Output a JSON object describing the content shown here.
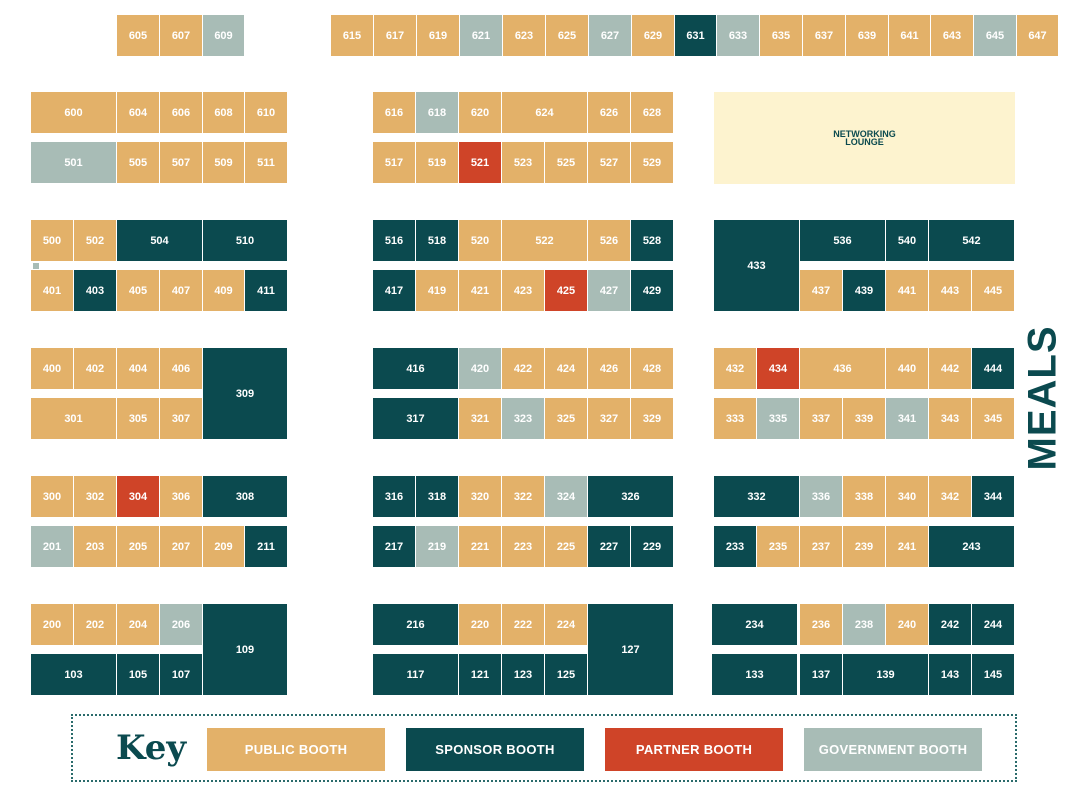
{
  "colors": {
    "public": "#e3b169",
    "sponsor": "#0b4a4f",
    "partner": "#cf4428",
    "government": "#a8bcb6",
    "lounge": "#fdf3cf"
  },
  "booths": [
    {
      "id": "605",
      "type": "public"
    },
    {
      "id": "607",
      "type": "public"
    },
    {
      "id": "609",
      "type": "government"
    },
    {
      "id": "615",
      "type": "public"
    },
    {
      "id": "617",
      "type": "public"
    },
    {
      "id": "619",
      "type": "public"
    },
    {
      "id": "621",
      "type": "government"
    },
    {
      "id": "623",
      "type": "public"
    },
    {
      "id": "625",
      "type": "public"
    },
    {
      "id": "627",
      "type": "government"
    },
    {
      "id": "629",
      "type": "public"
    },
    {
      "id": "631",
      "type": "sponsor"
    },
    {
      "id": "633",
      "type": "government"
    },
    {
      "id": "635",
      "type": "public"
    },
    {
      "id": "637",
      "type": "public"
    },
    {
      "id": "639",
      "type": "public"
    },
    {
      "id": "641",
      "type": "public"
    },
    {
      "id": "643",
      "type": "public"
    },
    {
      "id": "645",
      "type": "government"
    },
    {
      "id": "647",
      "type": "public"
    },
    {
      "id": "600",
      "type": "public"
    },
    {
      "id": "604",
      "type": "public"
    },
    {
      "id": "606",
      "type": "public"
    },
    {
      "id": "608",
      "type": "public"
    },
    {
      "id": "610",
      "type": "public"
    },
    {
      "id": "501",
      "type": "government"
    },
    {
      "id": "505",
      "type": "public"
    },
    {
      "id": "507",
      "type": "public"
    },
    {
      "id": "509",
      "type": "public"
    },
    {
      "id": "511",
      "type": "public"
    },
    {
      "id": "616",
      "type": "public"
    },
    {
      "id": "618",
      "type": "government"
    },
    {
      "id": "620",
      "type": "public"
    },
    {
      "id": "624",
      "type": "public"
    },
    {
      "id": "626",
      "type": "public"
    },
    {
      "id": "628",
      "type": "public"
    },
    {
      "id": "517",
      "type": "public"
    },
    {
      "id": "519",
      "type": "public"
    },
    {
      "id": "521",
      "type": "partner"
    },
    {
      "id": "523",
      "type": "public"
    },
    {
      "id": "525",
      "type": "public"
    },
    {
      "id": "527",
      "type": "public"
    },
    {
      "id": "529",
      "type": "public"
    },
    {
      "id": "500",
      "type": "public"
    },
    {
      "id": "502",
      "type": "public"
    },
    {
      "id": "504",
      "type": "sponsor"
    },
    {
      "id": "510",
      "type": "sponsor"
    },
    {
      "id": "401",
      "type": "public"
    },
    {
      "id": "403",
      "type": "sponsor"
    },
    {
      "id": "405",
      "type": "public"
    },
    {
      "id": "407",
      "type": "public"
    },
    {
      "id": "409",
      "type": "public"
    },
    {
      "id": "411",
      "type": "sponsor"
    },
    {
      "id": "516",
      "type": "sponsor"
    },
    {
      "id": "518",
      "type": "sponsor"
    },
    {
      "id": "520",
      "type": "public"
    },
    {
      "id": "522",
      "type": "public"
    },
    {
      "id": "526",
      "type": "public"
    },
    {
      "id": "528",
      "type": "sponsor"
    },
    {
      "id": "417",
      "type": "sponsor"
    },
    {
      "id": "419",
      "type": "public"
    },
    {
      "id": "421",
      "type": "public"
    },
    {
      "id": "423",
      "type": "public"
    },
    {
      "id": "425",
      "type": "partner"
    },
    {
      "id": "427",
      "type": "government"
    },
    {
      "id": "429",
      "type": "sponsor"
    },
    {
      "id": "433",
      "type": "sponsor"
    },
    {
      "id": "536",
      "type": "sponsor"
    },
    {
      "id": "540",
      "type": "sponsor"
    },
    {
      "id": "542",
      "type": "sponsor"
    },
    {
      "id": "437",
      "type": "public"
    },
    {
      "id": "439",
      "type": "sponsor"
    },
    {
      "id": "441",
      "type": "public"
    },
    {
      "id": "443",
      "type": "public"
    },
    {
      "id": "445",
      "type": "public"
    },
    {
      "id": "400",
      "type": "public"
    },
    {
      "id": "402",
      "type": "public"
    },
    {
      "id": "404",
      "type": "public"
    },
    {
      "id": "406",
      "type": "public"
    },
    {
      "id": "309",
      "type": "sponsor"
    },
    {
      "id": "301",
      "type": "public"
    },
    {
      "id": "305",
      "type": "public"
    },
    {
      "id": "307",
      "type": "public"
    },
    {
      "id": "416",
      "type": "sponsor"
    },
    {
      "id": "420",
      "type": "government"
    },
    {
      "id": "422",
      "type": "public"
    },
    {
      "id": "424",
      "type": "public"
    },
    {
      "id": "426",
      "type": "public"
    },
    {
      "id": "428",
      "type": "public"
    },
    {
      "id": "317",
      "type": "sponsor"
    },
    {
      "id": "321",
      "type": "public"
    },
    {
      "id": "323",
      "type": "government"
    },
    {
      "id": "325",
      "type": "public"
    },
    {
      "id": "327",
      "type": "public"
    },
    {
      "id": "329",
      "type": "public"
    },
    {
      "id": "432",
      "type": "public"
    },
    {
      "id": "434",
      "type": "partner"
    },
    {
      "id": "436",
      "type": "public"
    },
    {
      "id": "440",
      "type": "public"
    },
    {
      "id": "442",
      "type": "public"
    },
    {
      "id": "444",
      "type": "sponsor"
    },
    {
      "id": "333",
      "type": "public"
    },
    {
      "id": "335",
      "type": "government"
    },
    {
      "id": "337",
      "type": "public"
    },
    {
      "id": "339",
      "type": "public"
    },
    {
      "id": "341",
      "type": "government"
    },
    {
      "id": "343",
      "type": "public"
    },
    {
      "id": "345",
      "type": "public"
    },
    {
      "id": "300",
      "type": "public"
    },
    {
      "id": "302",
      "type": "public"
    },
    {
      "id": "304",
      "type": "partner"
    },
    {
      "id": "306",
      "type": "public"
    },
    {
      "id": "308",
      "type": "sponsor"
    },
    {
      "id": "201",
      "type": "government"
    },
    {
      "id": "203",
      "type": "public"
    },
    {
      "id": "205",
      "type": "public"
    },
    {
      "id": "207",
      "type": "public"
    },
    {
      "id": "209",
      "type": "public"
    },
    {
      "id": "211",
      "type": "sponsor"
    },
    {
      "id": "316",
      "type": "sponsor"
    },
    {
      "id": "318",
      "type": "sponsor"
    },
    {
      "id": "320",
      "type": "public"
    },
    {
      "id": "322",
      "type": "public"
    },
    {
      "id": "324",
      "type": "government"
    },
    {
      "id": "326",
      "type": "sponsor"
    },
    {
      "id": "217",
      "type": "sponsor"
    },
    {
      "id": "219",
      "type": "government"
    },
    {
      "id": "221",
      "type": "public"
    },
    {
      "id": "223",
      "type": "public"
    },
    {
      "id": "225",
      "type": "public"
    },
    {
      "id": "227",
      "type": "sponsor"
    },
    {
      "id": "229",
      "type": "sponsor"
    },
    {
      "id": "332",
      "type": "sponsor"
    },
    {
      "id": "336",
      "type": "government"
    },
    {
      "id": "338",
      "type": "public"
    },
    {
      "id": "340",
      "type": "public"
    },
    {
      "id": "342",
      "type": "public"
    },
    {
      "id": "344",
      "type": "sponsor"
    },
    {
      "id": "233",
      "type": "sponsor"
    },
    {
      "id": "235",
      "type": "public"
    },
    {
      "id": "237",
      "type": "public"
    },
    {
      "id": "239",
      "type": "public"
    },
    {
      "id": "241",
      "type": "public"
    },
    {
      "id": "243",
      "type": "sponsor"
    },
    {
      "id": "200",
      "type": "public"
    },
    {
      "id": "202",
      "type": "public"
    },
    {
      "id": "204",
      "type": "public"
    },
    {
      "id": "206",
      "type": "government"
    },
    {
      "id": "109",
      "type": "sponsor"
    },
    {
      "id": "103",
      "type": "sponsor"
    },
    {
      "id": "105",
      "type": "sponsor"
    },
    {
      "id": "107",
      "type": "sponsor"
    },
    {
      "id": "216",
      "type": "sponsor"
    },
    {
      "id": "220",
      "type": "public"
    },
    {
      "id": "222",
      "type": "public"
    },
    {
      "id": "224",
      "type": "public"
    },
    {
      "id": "127",
      "type": "sponsor"
    },
    {
      "id": "117",
      "type": "sponsor"
    },
    {
      "id": "121",
      "type": "sponsor"
    },
    {
      "id": "123",
      "type": "sponsor"
    },
    {
      "id": "125",
      "type": "sponsor"
    },
    {
      "id": "234",
      "type": "sponsor"
    },
    {
      "id": "236",
      "type": "public"
    },
    {
      "id": "238",
      "type": "government"
    },
    {
      "id": "240",
      "type": "public"
    },
    {
      "id": "242",
      "type": "sponsor"
    },
    {
      "id": "244",
      "type": "sponsor"
    },
    {
      "id": "133",
      "type": "sponsor"
    },
    {
      "id": "137",
      "type": "sponsor"
    },
    {
      "id": "139",
      "type": "sponsor"
    },
    {
      "id": "143",
      "type": "sponsor"
    },
    {
      "id": "145",
      "type": "sponsor"
    }
  ],
  "lounge": {
    "line1": "NETWORKING",
    "line2": "LOUNGE"
  },
  "meals_label": "MEALS",
  "key": {
    "title": "Key",
    "public": "PUBLIC BOOTH",
    "sponsor": "SPONSOR BOOTH",
    "partner": "PARTNER BOOTH",
    "government": "GOVERNMENT BOOTH"
  }
}
